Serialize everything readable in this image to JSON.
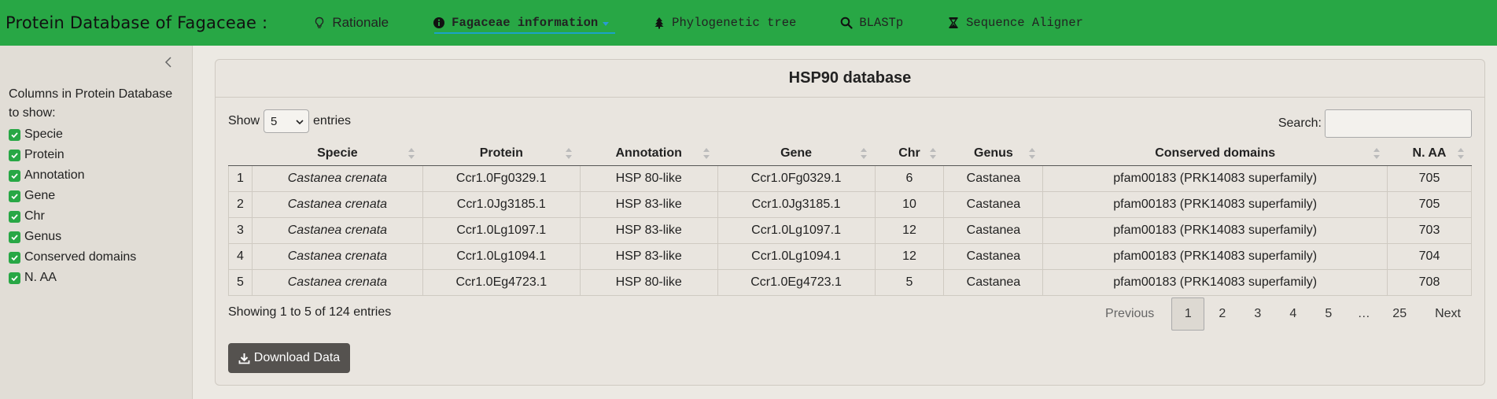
{
  "navbar": {
    "brand": "Protein Database of Fagaceae :",
    "items": [
      {
        "label": "Rationale",
        "icon": "lightbulb-icon"
      },
      {
        "label": "Fagaceae information",
        "icon": "info-circle-icon"
      },
      {
        "label": "Phylogenetic tree",
        "icon": "tree-icon"
      },
      {
        "label": "BLASTp",
        "icon": "search-icon"
      },
      {
        "label": "Sequence Aligner",
        "icon": "hourglass-icon"
      }
    ],
    "accent": "#28a745"
  },
  "sidebar": {
    "title": "Columns in Protein Database to show:",
    "columns": [
      "Specie",
      "Protein",
      "Annotation",
      "Gene",
      "Chr",
      "Genus",
      "Conserved domains",
      "N. AA"
    ]
  },
  "card": {
    "title": "HSP90 database",
    "show_label": "Show",
    "entries_label": "entries",
    "page_length": "5",
    "search_label": "Search:",
    "search_value": "",
    "headers": [
      "",
      "Specie",
      "Protein",
      "Annotation",
      "Gene",
      "Chr",
      "Genus",
      "Conserved domains",
      "N. AA"
    ],
    "rows": [
      [
        "1",
        "Castanea crenata",
        "Ccr1.0Fg0329.1",
        "HSP 80-like",
        "Ccr1.0Fg0329.1",
        "6",
        "Castanea",
        "pfam00183 (PRK14083 superfamily)",
        "705"
      ],
      [
        "2",
        "Castanea crenata",
        "Ccr1.0Jg3185.1",
        "HSP 83-like",
        "Ccr1.0Jg3185.1",
        "10",
        "Castanea",
        "pfam00183 (PRK14083 superfamily)",
        "705"
      ],
      [
        "3",
        "Castanea crenata",
        "Ccr1.0Lg1097.1",
        "HSP 83-like",
        "Ccr1.0Lg1097.1",
        "12",
        "Castanea",
        "pfam00183 (PRK14083 superfamily)",
        "703"
      ],
      [
        "4",
        "Castanea crenata",
        "Ccr1.0Lg1094.1",
        "HSP 83-like",
        "Ccr1.0Lg1094.1",
        "12",
        "Castanea",
        "pfam00183 (PRK14083 superfamily)",
        "704"
      ],
      [
        "5",
        "Castanea crenata",
        "Ccr1.0Eg4723.1",
        "HSP 80-like",
        "Ccr1.0Eg4723.1",
        "5",
        "Castanea",
        "pfam00183 (PRK14083 superfamily)",
        "708"
      ]
    ],
    "info": "Showing 1 to 5 of 124 entries",
    "pager": {
      "previous": "Previous",
      "pages": [
        "1",
        "2",
        "3",
        "4",
        "5",
        "…",
        "25"
      ],
      "current": "1",
      "next": "Next"
    },
    "download_label": "Download Data"
  }
}
